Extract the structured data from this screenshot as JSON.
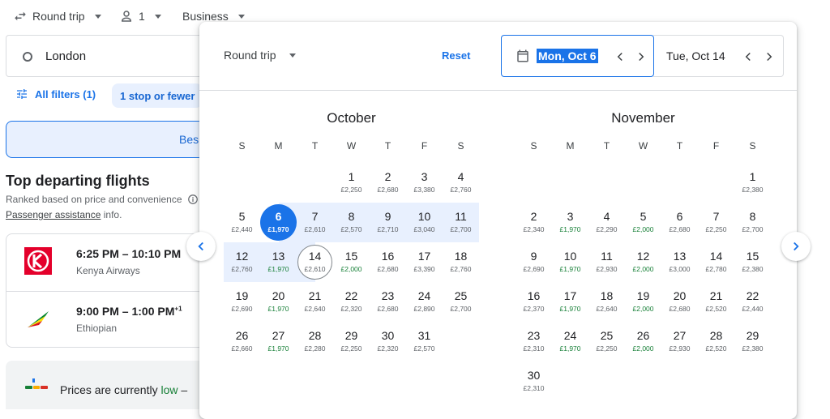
{
  "topbar": {
    "trip": "Round trip",
    "passengers": "1",
    "cabin": "Business"
  },
  "search": {
    "origin": "London"
  },
  "filters": {
    "all": "All filters (1)",
    "chip": "1 stop or fewer"
  },
  "tabs": {
    "best": "Bes"
  },
  "results": {
    "title": "Top departing flights",
    "subtitle": "Ranked based on price and convenience",
    "assist_link": "Passenger assistance",
    "assist_suffix": " info.",
    "flights": [
      {
        "time": "6:25 PM – 10:10 PM",
        "sup": "",
        "airline": "Kenya Airways"
      },
      {
        "time": "9:00 PM – 1:00 PM",
        "sup": "+1",
        "airline": "Ethiopian"
      }
    ],
    "prices_prefix": "Prices are currently ",
    "prices_low": "low",
    "prices_suffix": " –"
  },
  "picker": {
    "trip": "Round trip",
    "reset": "Reset",
    "depart": "Mon, Oct 6",
    "return": "Tue, Oct 14",
    "weekdays": [
      "S",
      "M",
      "T",
      "W",
      "T",
      "F",
      "S"
    ],
    "months": [
      {
        "name": "October",
        "start": 3,
        "days": [
          {
            "d": "1",
            "p": "£2,250"
          },
          {
            "d": "2",
            "p": "£2,680"
          },
          {
            "d": "3",
            "p": "£3,380"
          },
          {
            "d": "4",
            "p": "£2,760"
          },
          {
            "d": "5",
            "p": "£2,440"
          },
          {
            "d": "6",
            "p": "£1,970",
            "low": true,
            "sel": "depart"
          },
          {
            "d": "7",
            "p": "£2,610"
          },
          {
            "d": "8",
            "p": "£2,570"
          },
          {
            "d": "9",
            "p": "£2,710"
          },
          {
            "d": "10",
            "p": "£3,040"
          },
          {
            "d": "11",
            "p": "£2,700"
          },
          {
            "d": "12",
            "p": "£2,760"
          },
          {
            "d": "13",
            "p": "£1,970",
            "low": true
          },
          {
            "d": "14",
            "p": "£2,610",
            "sel": "return"
          },
          {
            "d": "15",
            "p": "£2,000",
            "low": true
          },
          {
            "d": "16",
            "p": "£2,680"
          },
          {
            "d": "17",
            "p": "£3,390"
          },
          {
            "d": "18",
            "p": "£2,760"
          },
          {
            "d": "19",
            "p": "£2,690"
          },
          {
            "d": "20",
            "p": "£1,970",
            "low": true
          },
          {
            "d": "21",
            "p": "£2,640"
          },
          {
            "d": "22",
            "p": "£2,320"
          },
          {
            "d": "23",
            "p": "£2,680"
          },
          {
            "d": "24",
            "p": "£2,890"
          },
          {
            "d": "25",
            "p": "£2,700"
          },
          {
            "d": "26",
            "p": "£2,660"
          },
          {
            "d": "27",
            "p": "£1,970",
            "low": true
          },
          {
            "d": "28",
            "p": "£2,280"
          },
          {
            "d": "29",
            "p": "£2,250"
          },
          {
            "d": "30",
            "p": "£2,320"
          },
          {
            "d": "31",
            "p": "£2,570"
          }
        ]
      },
      {
        "name": "November",
        "start": 6,
        "days": [
          {
            "d": "1",
            "p": "£2,380"
          },
          {
            "d": "2",
            "p": "£2,340"
          },
          {
            "d": "3",
            "p": "£1,970",
            "low": true
          },
          {
            "d": "4",
            "p": "£2,290"
          },
          {
            "d": "5",
            "p": "£2,000",
            "low": true
          },
          {
            "d": "6",
            "p": "£2,680"
          },
          {
            "d": "7",
            "p": "£2,250"
          },
          {
            "d": "8",
            "p": "£2,700"
          },
          {
            "d": "9",
            "p": "£2,690"
          },
          {
            "d": "10",
            "p": "£1,970",
            "low": true
          },
          {
            "d": "11",
            "p": "£2,930"
          },
          {
            "d": "12",
            "p": "£2,000",
            "low": true
          },
          {
            "d": "13",
            "p": "£3,000"
          },
          {
            "d": "14",
            "p": "£2,780"
          },
          {
            "d": "15",
            "p": "£2,380"
          },
          {
            "d": "16",
            "p": "£2,370"
          },
          {
            "d": "17",
            "p": "£1,970",
            "low": true
          },
          {
            "d": "18",
            "p": "£2,640"
          },
          {
            "d": "19",
            "p": "£2,000",
            "low": true
          },
          {
            "d": "20",
            "p": "£2,680"
          },
          {
            "d": "21",
            "p": "£2,520"
          },
          {
            "d": "22",
            "p": "£2,440"
          },
          {
            "d": "23",
            "p": "£2,310"
          },
          {
            "d": "24",
            "p": "£1,970",
            "low": true
          },
          {
            "d": "25",
            "p": "£2,250"
          },
          {
            "d": "26",
            "p": "£2,000",
            "low": true
          },
          {
            "d": "27",
            "p": "£2,930"
          },
          {
            "d": "28",
            "p": "£2,520"
          },
          {
            "d": "29",
            "p": "£2,380"
          },
          {
            "d": "30",
            "p": "£2,310"
          }
        ]
      }
    ]
  },
  "colors": {
    "accent": "#1a73e8",
    "range": "#e8f0fe",
    "low_price": "#188038",
    "kenya_red": "#e4002b"
  }
}
